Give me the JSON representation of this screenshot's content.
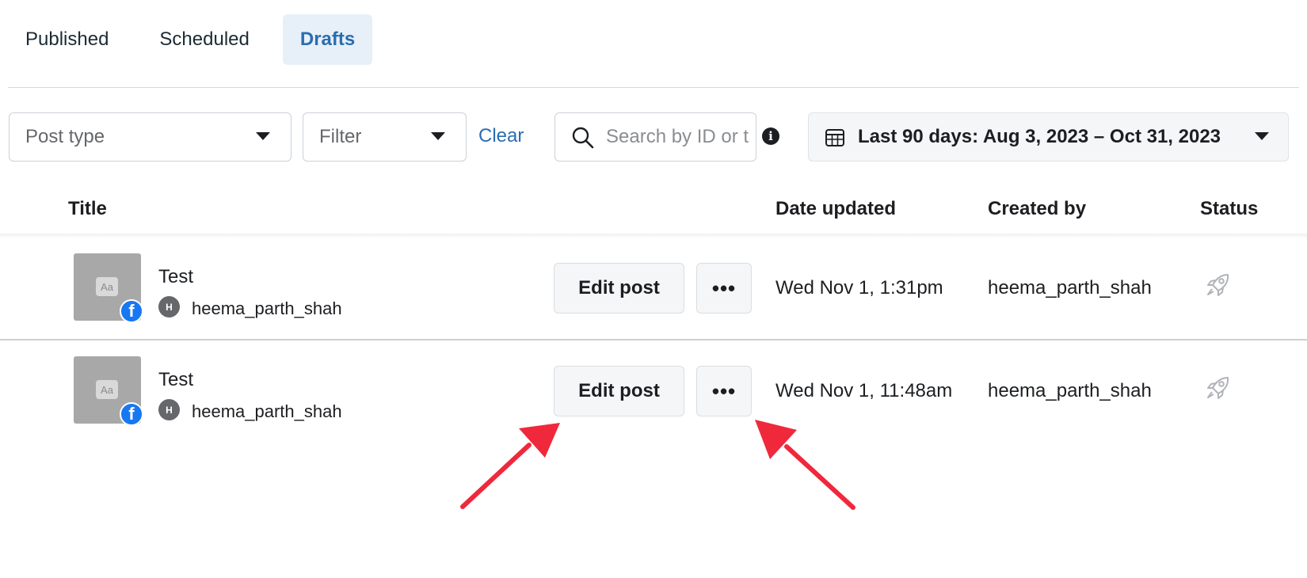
{
  "tabs": [
    {
      "label": "Published",
      "active": false
    },
    {
      "label": "Scheduled",
      "active": false
    },
    {
      "label": "Drafts",
      "active": true
    }
  ],
  "toolbar": {
    "post_type_placeholder": "Post type",
    "filter_placeholder": "Filter",
    "clear_label": "Clear",
    "search_placeholder": "Search by ID or title",
    "info_icon": "info-icon",
    "date_range_label": "Last 90 days: Aug 3, 2023 – Oct 31, 2023",
    "date_range_icon": "calendar-icon"
  },
  "table": {
    "columns": {
      "title": "Title",
      "date_updated": "Date updated",
      "created_by": "Created by",
      "status": "Status"
    },
    "rows": [
      {
        "title": "Test",
        "author_initial": "H",
        "author": "heema_parth_shah",
        "thumbnail_text": "Aa",
        "edit_label": "Edit post",
        "more_label": "•••",
        "date_updated": "Wed Nov 1, 1:31pm",
        "created_by": "heema_parth_shah",
        "status_icon": "rocket-icon"
      },
      {
        "title": "Test",
        "author_initial": "H",
        "author": "heema_parth_shah",
        "thumbnail_text": "Aa",
        "edit_label": "Edit post",
        "more_label": "•••",
        "date_updated": "Wed Nov 1, 11:48am",
        "created_by": "heema_parth_shah",
        "status_icon": "rocket-icon"
      }
    ]
  },
  "colors": {
    "accent": "#2a6db0",
    "active_tab_bg": "#e7f0f8",
    "facebook_blue": "#1877f2",
    "annotation_arrow": "#f0283c"
  }
}
